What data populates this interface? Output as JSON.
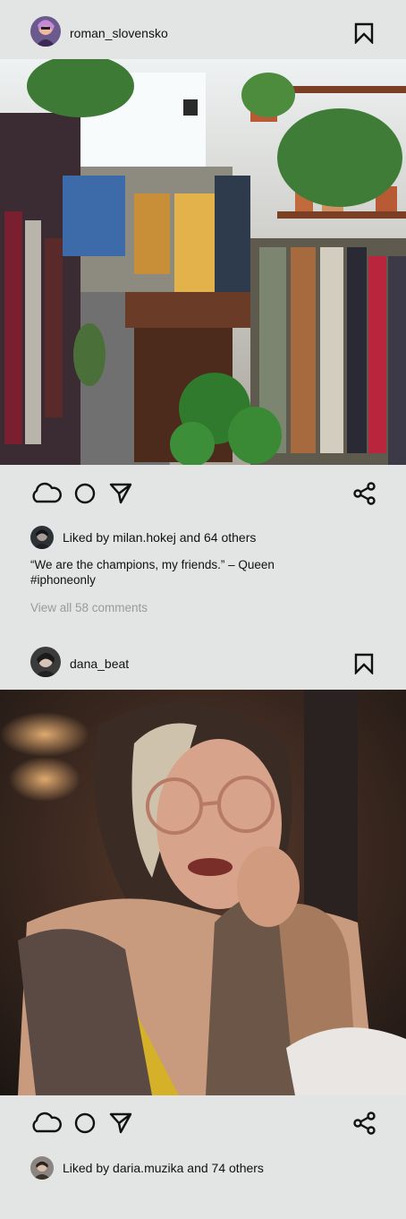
{
  "posts": [
    {
      "username": "roman_slovensko",
      "photo_label": "Interior of a vintage clothing shop with racks of clothes, plants and a wooden counter",
      "liked_by_prefix": "Liked by ",
      "liked_by_user": "milan.hokej",
      "liked_by_suffix": " and 64 others",
      "caption_line1": "“We are the champions, my friends.” – Queen",
      "caption_line2": "#iphoneonly",
      "view_comments": "View all 58 comments"
    },
    {
      "username": "dana_beat",
      "photo_label": "Portrait of a tattooed woman wearing round glasses, resting her chin on her hand",
      "liked_by_prefix": "Liked by ",
      "liked_by_user": "daria.muzika",
      "liked_by_suffix": " and 74 others"
    }
  ],
  "icons": {
    "like": "cloud-icon",
    "comment": "circle-icon",
    "send": "paper-plane-icon",
    "share": "share-icon",
    "save": "bookmark-icon"
  },
  "colors": {
    "background": "#e3e4e4",
    "text": "#111111",
    "muted": "#9a9a9a"
  }
}
